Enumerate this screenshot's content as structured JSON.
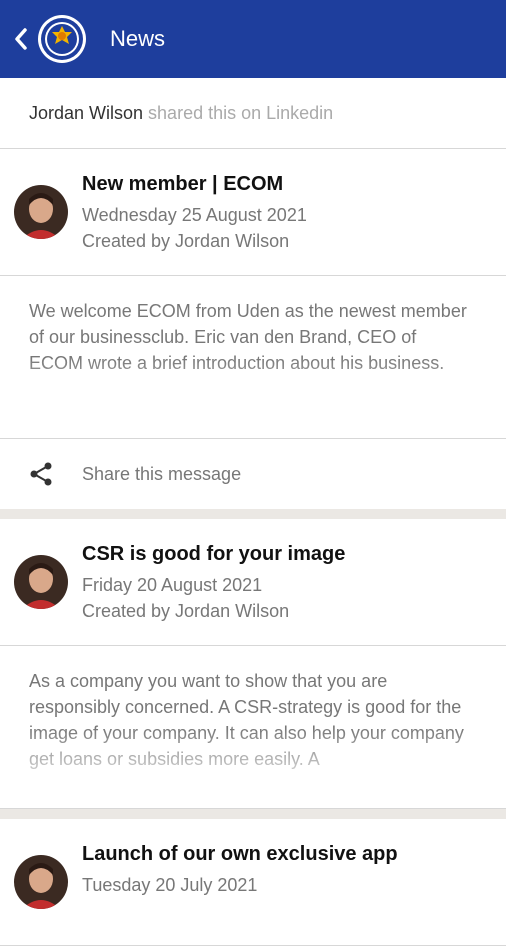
{
  "header": {
    "title": "News",
    "back_icon": "chevron-left-icon",
    "logo": "club-crest-logo"
  },
  "shared_banner": {
    "name": "Jordan Wilson",
    "text": "shared this on Linkedin"
  },
  "posts": [
    {
      "title": "New member | ECOM",
      "date": "Wednesday 25 August 2021",
      "created_by": "Created by Jordan Wilson",
      "excerpt": "We welcome ECOM from Uden as the newest member of our businessclub. Eric van den Brand, CEO of ECOM wrote a brief introduction about his business.",
      "share_label": "Share this message"
    },
    {
      "title": "CSR is good for your image",
      "date": "Friday 20 August 2021",
      "created_by": "Created by Jordan Wilson",
      "excerpt": "As a company you want to show that you are responsibly concerned. A CSR-strategy is good for the image of your company. It can also help your company get loans or subsidies more easily. A"
    },
    {
      "title": "Launch of our own exclusive app",
      "date": "Tuesday 20 July 2021"
    }
  ],
  "colors": {
    "appbar": "#1e3e9d",
    "muted": "#777777",
    "divider": "#d7d7d7"
  }
}
